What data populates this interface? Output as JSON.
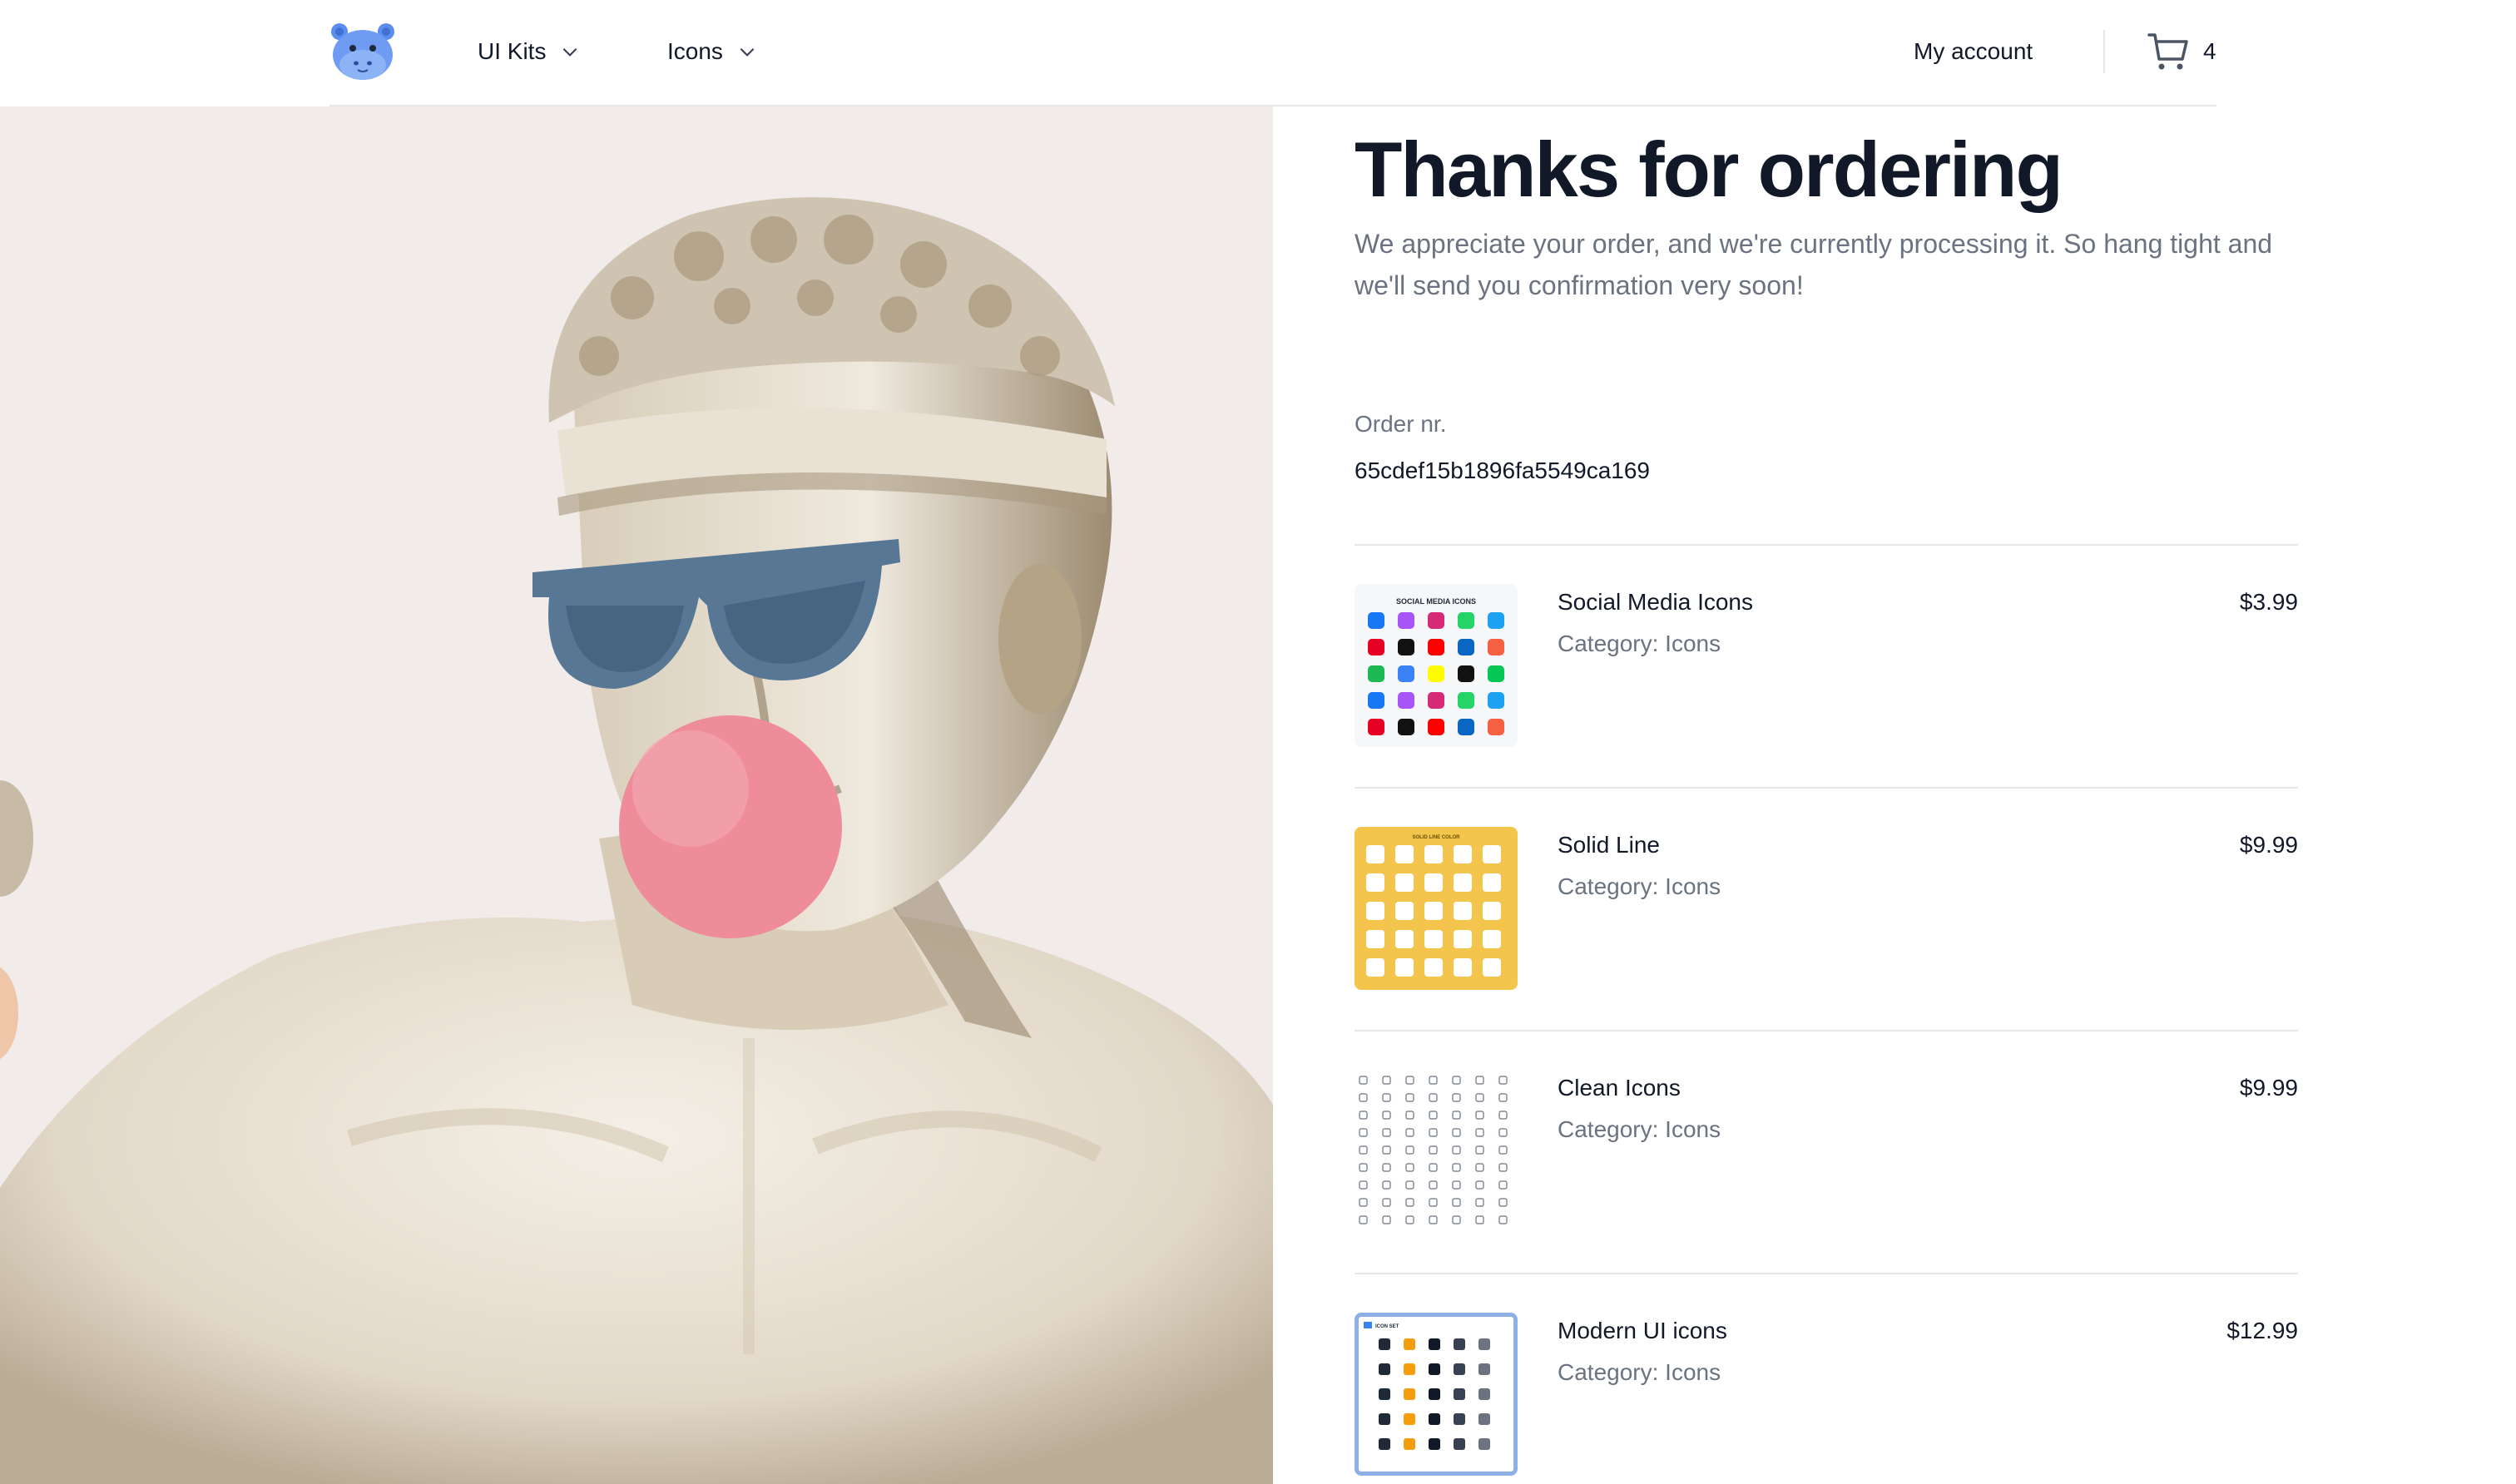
{
  "header": {
    "logo_icon": "hippo-logo-icon",
    "nav": [
      {
        "label": "UI Kits",
        "icon": "chevron-down-icon"
      },
      {
        "label": "Icons",
        "icon": "chevron-down-icon"
      }
    ],
    "account_label": "My account",
    "cart_icon": "shopping-cart-icon",
    "cart_count": "4"
  },
  "hero": {
    "image": "statue-with-sunglasses-and-bubblegum"
  },
  "order": {
    "title": "Thanks for ordering",
    "subtitle": "We appreciate your order, and we're currently processing it. So hang tight and we'll send you confirmation very soon!",
    "number_label": "Order nr.",
    "number": "65cdef15b1896fa5549ca169",
    "items": [
      {
        "name": "Social Media Icons",
        "category": "Category: Icons",
        "price": "$3.99",
        "thumb_title": "SOCIAL MEDIA ICONS"
      },
      {
        "name": "Solid Line",
        "category": "Category: Icons",
        "price": "$9.99",
        "thumb_title": "SOLID LINE COLOR"
      },
      {
        "name": "Clean Icons",
        "category": "Category: Icons",
        "price": "$9.99"
      },
      {
        "name": "Modern UI icons",
        "category": "Category: Icons",
        "price": "$12.99",
        "thumb_title": "ICON SET"
      }
    ]
  },
  "colors": {
    "text": "#111827",
    "muted": "#6b7280",
    "divider": "#e5e7eb",
    "hero_bg": "#f1ebe9",
    "logo_blue": "#5b8def",
    "bubblegum": "#ee8c9a",
    "sunglasses": "#4f6e8a",
    "solid_line_thumb": "#f3c54d"
  }
}
